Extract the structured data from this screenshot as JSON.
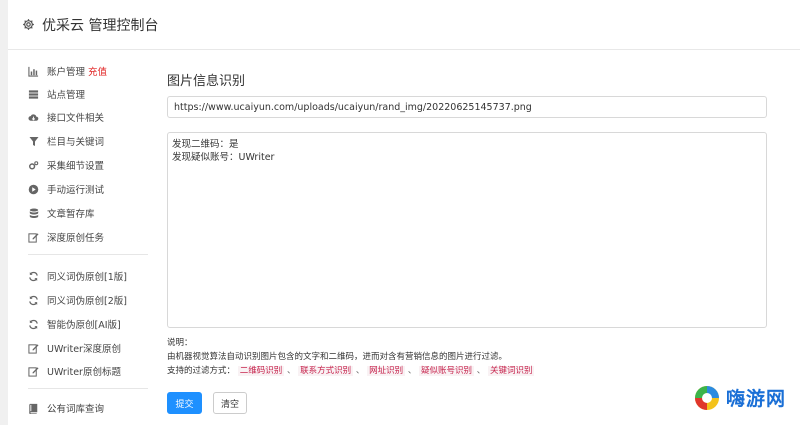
{
  "header": {
    "title": "优采云 管理控制台",
    "icon": "gear-icon"
  },
  "sidebar": {
    "items": [
      {
        "label": "账户管理",
        "badge": "充值",
        "icon": "bar-chart-icon"
      },
      {
        "label": "站点管理",
        "icon": "server-icon"
      },
      {
        "label": "接口文件相关",
        "icon": "cloud-download-icon"
      },
      {
        "label": "栏目与关键词",
        "icon": "filter-icon"
      },
      {
        "label": "采集细节设置",
        "icon": "cogs-icon"
      },
      {
        "label": "手动运行测试",
        "icon": "play-circle-icon"
      },
      {
        "label": "文章暂存库",
        "icon": "database-icon"
      },
      {
        "label": "深度原创任务",
        "icon": "edit-icon"
      },
      {
        "label": "同义词伪原创[1版]",
        "icon": "refresh-icon"
      },
      {
        "label": "同义词伪原创[2版]",
        "icon": "refresh-icon"
      },
      {
        "label": "智能伪原创[AI版]",
        "icon": "refresh-icon"
      },
      {
        "label": "UWriter深度原创",
        "icon": "edit-icon"
      },
      {
        "label": "UWriter原创标题",
        "icon": "edit-icon"
      },
      {
        "label": "公有词库查询",
        "icon": "book-icon"
      }
    ]
  },
  "main": {
    "title": "图片信息识别",
    "url_value": "https://www.ucaiyun.com/uploads/ucaiyun/rand_img/20220625145737.png",
    "result_lines": [
      "发现二维码：是",
      "发现疑似账号：UWriter"
    ],
    "notes_label": "说明：",
    "notes_desc": "由机器视觉算法自动识别图片包含的文字和二维码，进而对含有营销信息的图片进行过滤。",
    "filter_prefix": "支持的过滤方式：",
    "filter_tags": [
      "二维码识别",
      "联系方式识别",
      "网址识别",
      "疑似账号识别",
      "关键词识别"
    ],
    "filter_sep": "、",
    "submit_label": "提交",
    "clear_label": "清空"
  },
  "watermark": {
    "text": "嗨游网"
  },
  "colors": {
    "primary": "#1e90ff",
    "badge": "#e02020",
    "tag_text": "#c7254e",
    "tag_bg": "#f9f2f4",
    "watermark": "#1a6fd6"
  }
}
